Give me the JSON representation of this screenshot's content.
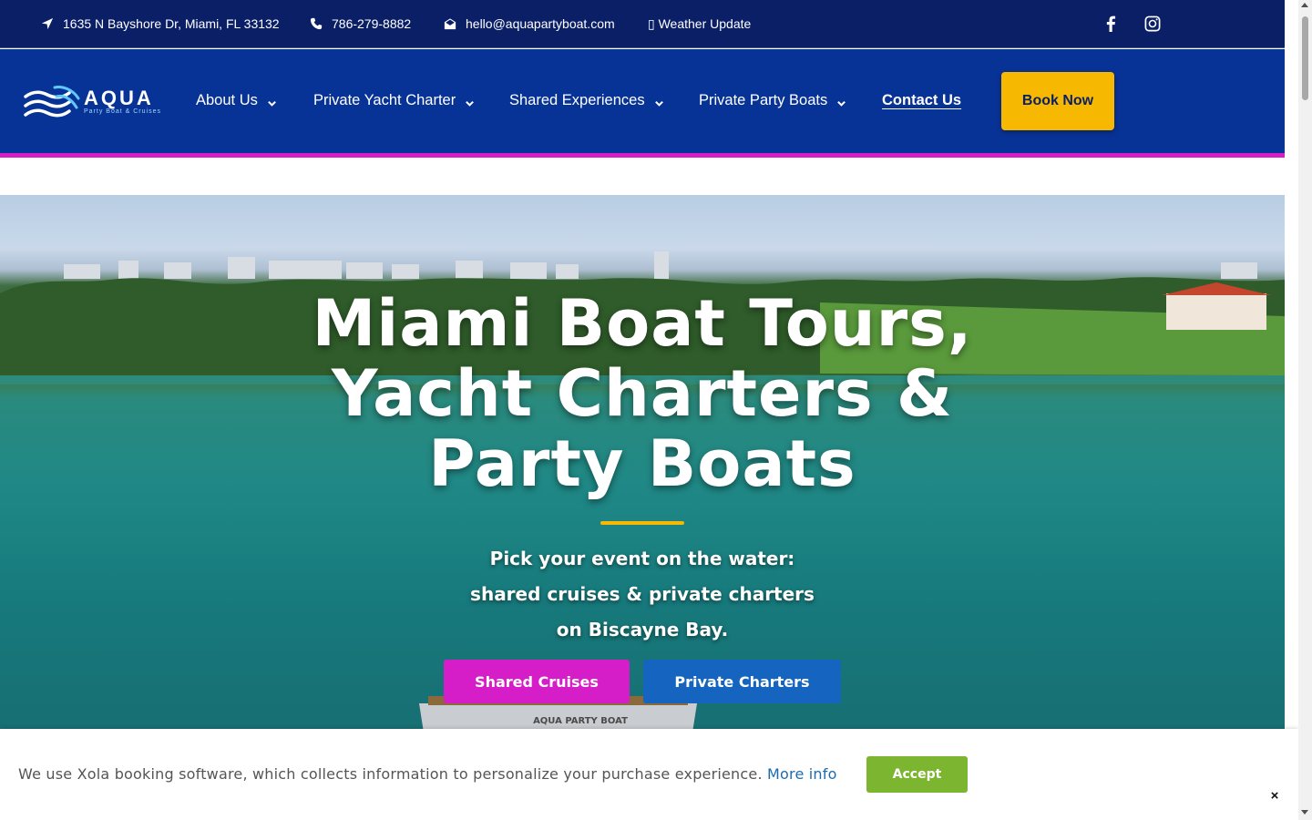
{
  "topbar": {
    "address": "1635 N Bayshore Dr, Miami, FL 33132",
    "phone": "786-279-8882",
    "email": "hello@aquapartyboat.com",
    "weather": "▯ Weather Update",
    "address_icon": "location-arrow-icon",
    "phone_icon": "phone-icon",
    "email_icon": "envelope-open-icon",
    "social": [
      "facebook-icon",
      "instagram-icon"
    ]
  },
  "logo": {
    "name": "AQUA",
    "tagline": "Party Boat & Cruises"
  },
  "nav": {
    "items": [
      {
        "label": "About Us",
        "dropdown": true
      },
      {
        "label": "Private Yacht Charter",
        "dropdown": true
      },
      {
        "label": "Shared Experiences",
        "dropdown": true
      },
      {
        "label": "Private Party Boats",
        "dropdown": true
      }
    ],
    "contact": "Contact Us",
    "book_now": "Book Now"
  },
  "hero": {
    "title_lines": [
      "Miami Boat Tours,",
      "Yacht Charters &",
      "Party Boats"
    ],
    "subtitle_lines": [
      "Pick your event on the water:",
      "shared cruises & private charters",
      "on Biscayne Bay."
    ],
    "btn_shared": "Shared Cruises",
    "btn_private": "Private Charters",
    "boat_label": "AQUA PARTY BOAT"
  },
  "cookie": {
    "text": "We use Xola booking software, which collects information to personalize your purchase experience.",
    "link": "More info",
    "accept": "Accept",
    "close": "×"
  },
  "colors": {
    "topbar_bg": "#0a1f66",
    "nav_bg": "#083396",
    "accent_magenta": "#d61ec8",
    "accent_yellow": "#f6b800",
    "accent_blue": "#1565c0",
    "accept_green": "#7cb530"
  }
}
